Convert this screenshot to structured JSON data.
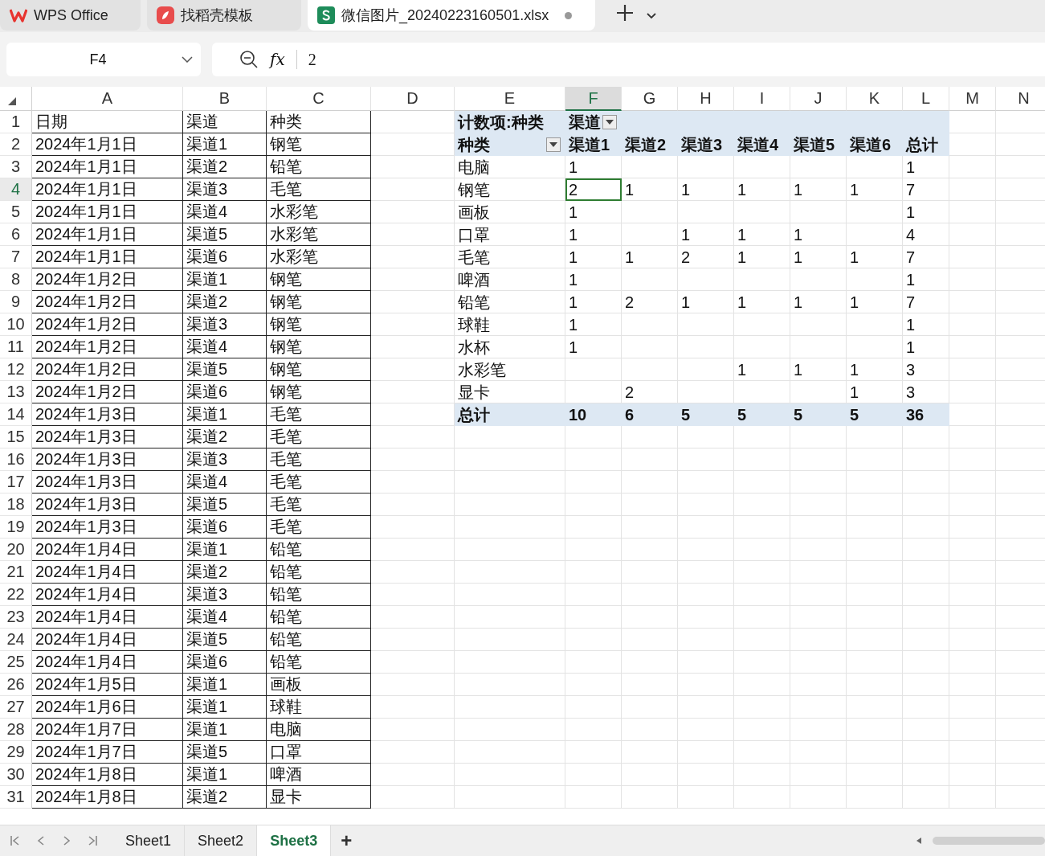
{
  "tabs": [
    {
      "label": "WPS Office",
      "kind": "wps",
      "selected": false,
      "unsaved": false
    },
    {
      "label": "找稻壳模板",
      "kind": "docer",
      "selected": false,
      "unsaved": false
    },
    {
      "label": "微信图片_20240223160501.xlsx",
      "kind": "sheet",
      "selected": true,
      "unsaved": true
    }
  ],
  "name_box": {
    "value": "F4"
  },
  "formula_bar": {
    "function_label": "fx",
    "value": "2"
  },
  "columns": [
    {
      "label": "A",
      "selected": false
    },
    {
      "label": "B",
      "selected": false
    },
    {
      "label": "C",
      "selected": false
    },
    {
      "label": "D",
      "selected": false
    },
    {
      "label": "E",
      "selected": false
    },
    {
      "label": "F",
      "selected": true
    },
    {
      "label": "G",
      "selected": false
    },
    {
      "label": "H",
      "selected": false
    },
    {
      "label": "I",
      "selected": false
    },
    {
      "label": "J",
      "selected": false
    },
    {
      "label": "K",
      "selected": false
    },
    {
      "label": "L",
      "selected": false
    },
    {
      "label": "M",
      "selected": false
    },
    {
      "label": "N",
      "selected": false
    }
  ],
  "row_numbers": [
    {
      "label": "1",
      "selected": false
    },
    {
      "label": "2",
      "selected": false
    },
    {
      "label": "3",
      "selected": false
    },
    {
      "label": "4",
      "selected": true
    },
    {
      "label": "5",
      "selected": false
    },
    {
      "label": "6",
      "selected": false
    },
    {
      "label": "7",
      "selected": false
    },
    {
      "label": "8",
      "selected": false
    },
    {
      "label": "9",
      "selected": false
    },
    {
      "label": "10",
      "selected": false
    },
    {
      "label": "11",
      "selected": false
    },
    {
      "label": "12",
      "selected": false
    },
    {
      "label": "13",
      "selected": false
    },
    {
      "label": "14",
      "selected": false
    },
    {
      "label": "15",
      "selected": false
    },
    {
      "label": "16",
      "selected": false
    },
    {
      "label": "17",
      "selected": false
    },
    {
      "label": "18",
      "selected": false
    },
    {
      "label": "19",
      "selected": false
    },
    {
      "label": "20",
      "selected": false
    },
    {
      "label": "21",
      "selected": false
    },
    {
      "label": "22",
      "selected": false
    },
    {
      "label": "23",
      "selected": false
    },
    {
      "label": "24",
      "selected": false
    },
    {
      "label": "25",
      "selected": false
    },
    {
      "label": "26",
      "selected": false
    },
    {
      "label": "27",
      "selected": false
    },
    {
      "label": "28",
      "selected": false
    },
    {
      "label": "29",
      "selected": false
    },
    {
      "label": "30",
      "selected": false
    },
    {
      "label": "31",
      "selected": false
    }
  ],
  "data_table": {
    "rows": [
      [
        "日期",
        "渠道",
        "种类"
      ],
      [
        "2024年1月1日",
        "渠道1",
        "钢笔"
      ],
      [
        "2024年1月1日",
        "渠道2",
        "铅笔"
      ],
      [
        "2024年1月1日",
        "渠道3",
        "毛笔"
      ],
      [
        "2024年1月1日",
        "渠道4",
        "水彩笔"
      ],
      [
        "2024年1月1日",
        "渠道5",
        "水彩笔"
      ],
      [
        "2024年1月1日",
        "渠道6",
        "水彩笔"
      ],
      [
        "2024年1月2日",
        "渠道1",
        "钢笔"
      ],
      [
        "2024年1月2日",
        "渠道2",
        "钢笔"
      ],
      [
        "2024年1月2日",
        "渠道3",
        "钢笔"
      ],
      [
        "2024年1月2日",
        "渠道4",
        "钢笔"
      ],
      [
        "2024年1月2日",
        "渠道5",
        "钢笔"
      ],
      [
        "2024年1月2日",
        "渠道6",
        "钢笔"
      ],
      [
        "2024年1月3日",
        "渠道1",
        "毛笔"
      ],
      [
        "2024年1月3日",
        "渠道2",
        "毛笔"
      ],
      [
        "2024年1月3日",
        "渠道3",
        "毛笔"
      ],
      [
        "2024年1月3日",
        "渠道4",
        "毛笔"
      ],
      [
        "2024年1月3日",
        "渠道5",
        "毛笔"
      ],
      [
        "2024年1月3日",
        "渠道6",
        "毛笔"
      ],
      [
        "2024年1月4日",
        "渠道1",
        "铅笔"
      ],
      [
        "2024年1月4日",
        "渠道2",
        "铅笔"
      ],
      [
        "2024年1月4日",
        "渠道3",
        "铅笔"
      ],
      [
        "2024年1月4日",
        "渠道4",
        "铅笔"
      ],
      [
        "2024年1月4日",
        "渠道5",
        "铅笔"
      ],
      [
        "2024年1月4日",
        "渠道6",
        "铅笔"
      ],
      [
        "2024年1月5日",
        "渠道1",
        "画板"
      ],
      [
        "2024年1月6日",
        "渠道1",
        "球鞋"
      ],
      [
        "2024年1月7日",
        "渠道1",
        "电脑"
      ],
      [
        "2024年1月7日",
        "渠道5",
        "口罩"
      ],
      [
        "2024年1月8日",
        "渠道1",
        "啤酒"
      ],
      [
        "2024年1月8日",
        "渠道2",
        "显卡"
      ]
    ]
  },
  "pivot": {
    "title": "计数项:种类",
    "column_field": "渠道",
    "row_field": "种类",
    "columns": [
      "渠道1",
      "渠道2",
      "渠道3",
      "渠道4",
      "渠道5",
      "渠道6",
      "总计"
    ],
    "rows": [
      {
        "label": "电脑",
        "values": {
          "F": "1",
          "L": "1"
        }
      },
      {
        "label": "钢笔",
        "values": {
          "F": "2",
          "G": "1",
          "H": "1",
          "I": "1",
          "J": "1",
          "K": "1",
          "L": "7"
        }
      },
      {
        "label": "画板",
        "values": {
          "F": "1",
          "L": "1"
        }
      },
      {
        "label": "口罩",
        "values": {
          "F": "1",
          "H": "1",
          "I": "1",
          "J": "1",
          "L": "4"
        }
      },
      {
        "label": "毛笔",
        "values": {
          "F": "1",
          "G": "1",
          "H": "2",
          "I": "1",
          "J": "1",
          "K": "1",
          "L": "7"
        }
      },
      {
        "label": "啤酒",
        "values": {
          "F": "1",
          "L": "1"
        }
      },
      {
        "label": "铅笔",
        "values": {
          "F": "1",
          "G": "2",
          "H": "1",
          "I": "1",
          "J": "1",
          "K": "1",
          "L": "7"
        }
      },
      {
        "label": "球鞋",
        "values": {
          "F": "1",
          "L": "1"
        }
      },
      {
        "label": "水杯",
        "values": {
          "F": "1",
          "L": "1"
        }
      },
      {
        "label": "水彩笔",
        "values": {
          "I": "1",
          "J": "1",
          "K": "1",
          "L": "3"
        }
      },
      {
        "label": "显卡",
        "values": {
          "G": "2",
          "K": "1",
          "L": "3"
        }
      }
    ],
    "total": {
      "label": "总计",
      "values": [
        "10",
        "6",
        "5",
        "5",
        "5",
        "5",
        "36"
      ]
    }
  },
  "sheet_tabs": [
    {
      "label": "Sheet1",
      "selected": false
    },
    {
      "label": "Sheet2",
      "selected": false
    },
    {
      "label": "Sheet3",
      "selected": true
    }
  ],
  "add_sheet": "+"
}
